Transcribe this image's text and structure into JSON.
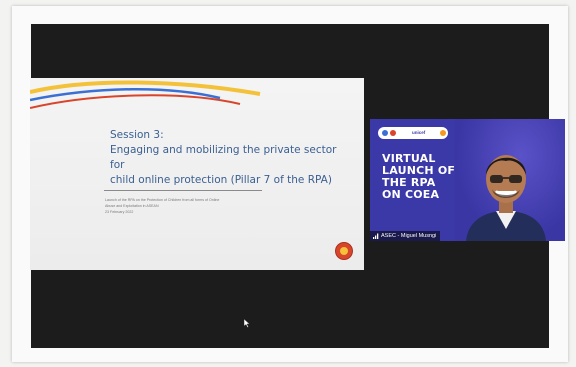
{
  "slide": {
    "session": "Session 3:",
    "title_line1": "Engaging and mobilizing the private sector for",
    "title_line2": "child online protection (Pillar 7 of the RPA)",
    "meta_line1": "Launch of the RPA on the Protection of Children from all forms of Online",
    "meta_line2": "Abuse and Exploitation in ASEAN",
    "meta_date": "23 February 2022",
    "logo_icon": "asean-emblem-icon"
  },
  "video": {
    "partner_label": "unicef",
    "title_lines": [
      "VIRTUAL",
      "LAUNCH OF",
      "THE RPA",
      "ON COEA"
    ],
    "participant_name": "ASEC - Miguel Musngi",
    "signal_icon": "signal-bars-icon"
  },
  "colors": {
    "screen_bg": "#1c1c1c",
    "slide_title": "#3a5f92",
    "video_bg": "#3b38a8",
    "slide_swoosh_yellow": "#f3c23a",
    "slide_swoosh_red": "#d9452c",
    "slide_swoosh_blue": "#3b6fd4"
  }
}
